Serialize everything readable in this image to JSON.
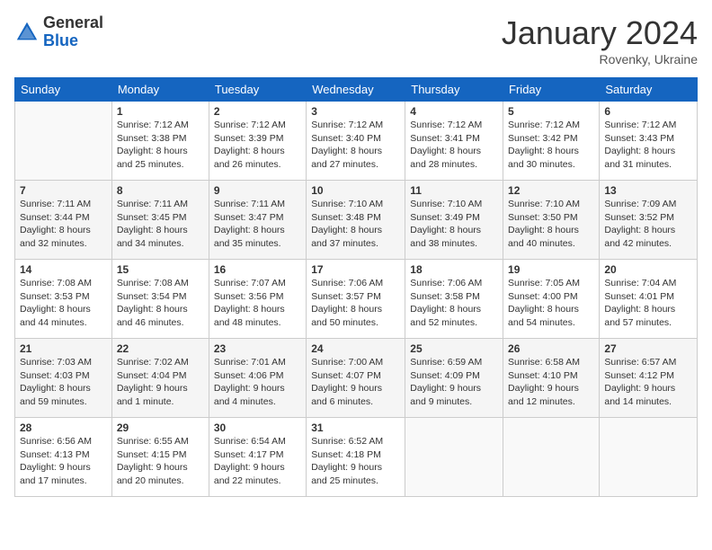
{
  "header": {
    "logo": {
      "general": "General",
      "blue": "Blue"
    },
    "title": "January 2024",
    "location": "Rovenky, Ukraine"
  },
  "weekdays": [
    "Sunday",
    "Monday",
    "Tuesday",
    "Wednesday",
    "Thursday",
    "Friday",
    "Saturday"
  ],
  "weeks": [
    [
      {
        "day": "",
        "empty": true
      },
      {
        "day": "1",
        "sunrise": "Sunrise: 7:12 AM",
        "sunset": "Sunset: 3:38 PM",
        "daylight": "Daylight: 8 hours and 25 minutes."
      },
      {
        "day": "2",
        "sunrise": "Sunrise: 7:12 AM",
        "sunset": "Sunset: 3:39 PM",
        "daylight": "Daylight: 8 hours and 26 minutes."
      },
      {
        "day": "3",
        "sunrise": "Sunrise: 7:12 AM",
        "sunset": "Sunset: 3:40 PM",
        "daylight": "Daylight: 8 hours and 27 minutes."
      },
      {
        "day": "4",
        "sunrise": "Sunrise: 7:12 AM",
        "sunset": "Sunset: 3:41 PM",
        "daylight": "Daylight: 8 hours and 28 minutes."
      },
      {
        "day": "5",
        "sunrise": "Sunrise: 7:12 AM",
        "sunset": "Sunset: 3:42 PM",
        "daylight": "Daylight: 8 hours and 30 minutes."
      },
      {
        "day": "6",
        "sunrise": "Sunrise: 7:12 AM",
        "sunset": "Sunset: 3:43 PM",
        "daylight": "Daylight: 8 hours and 31 minutes."
      }
    ],
    [
      {
        "day": "7",
        "sunrise": "Sunrise: 7:11 AM",
        "sunset": "Sunset: 3:44 PM",
        "daylight": "Daylight: 8 hours and 32 minutes."
      },
      {
        "day": "8",
        "sunrise": "Sunrise: 7:11 AM",
        "sunset": "Sunset: 3:45 PM",
        "daylight": "Daylight: 8 hours and 34 minutes."
      },
      {
        "day": "9",
        "sunrise": "Sunrise: 7:11 AM",
        "sunset": "Sunset: 3:47 PM",
        "daylight": "Daylight: 8 hours and 35 minutes."
      },
      {
        "day": "10",
        "sunrise": "Sunrise: 7:10 AM",
        "sunset": "Sunset: 3:48 PM",
        "daylight": "Daylight: 8 hours and 37 minutes."
      },
      {
        "day": "11",
        "sunrise": "Sunrise: 7:10 AM",
        "sunset": "Sunset: 3:49 PM",
        "daylight": "Daylight: 8 hours and 38 minutes."
      },
      {
        "day": "12",
        "sunrise": "Sunrise: 7:10 AM",
        "sunset": "Sunset: 3:50 PM",
        "daylight": "Daylight: 8 hours and 40 minutes."
      },
      {
        "day": "13",
        "sunrise": "Sunrise: 7:09 AM",
        "sunset": "Sunset: 3:52 PM",
        "daylight": "Daylight: 8 hours and 42 minutes."
      }
    ],
    [
      {
        "day": "14",
        "sunrise": "Sunrise: 7:08 AM",
        "sunset": "Sunset: 3:53 PM",
        "daylight": "Daylight: 8 hours and 44 minutes."
      },
      {
        "day": "15",
        "sunrise": "Sunrise: 7:08 AM",
        "sunset": "Sunset: 3:54 PM",
        "daylight": "Daylight: 8 hours and 46 minutes."
      },
      {
        "day": "16",
        "sunrise": "Sunrise: 7:07 AM",
        "sunset": "Sunset: 3:56 PM",
        "daylight": "Daylight: 8 hours and 48 minutes."
      },
      {
        "day": "17",
        "sunrise": "Sunrise: 7:06 AM",
        "sunset": "Sunset: 3:57 PM",
        "daylight": "Daylight: 8 hours and 50 minutes."
      },
      {
        "day": "18",
        "sunrise": "Sunrise: 7:06 AM",
        "sunset": "Sunset: 3:58 PM",
        "daylight": "Daylight: 8 hours and 52 minutes."
      },
      {
        "day": "19",
        "sunrise": "Sunrise: 7:05 AM",
        "sunset": "Sunset: 4:00 PM",
        "daylight": "Daylight: 8 hours and 54 minutes."
      },
      {
        "day": "20",
        "sunrise": "Sunrise: 7:04 AM",
        "sunset": "Sunset: 4:01 PM",
        "daylight": "Daylight: 8 hours and 57 minutes."
      }
    ],
    [
      {
        "day": "21",
        "sunrise": "Sunrise: 7:03 AM",
        "sunset": "Sunset: 4:03 PM",
        "daylight": "Daylight: 8 hours and 59 minutes."
      },
      {
        "day": "22",
        "sunrise": "Sunrise: 7:02 AM",
        "sunset": "Sunset: 4:04 PM",
        "daylight": "Daylight: 9 hours and 1 minute."
      },
      {
        "day": "23",
        "sunrise": "Sunrise: 7:01 AM",
        "sunset": "Sunset: 4:06 PM",
        "daylight": "Daylight: 9 hours and 4 minutes."
      },
      {
        "day": "24",
        "sunrise": "Sunrise: 7:00 AM",
        "sunset": "Sunset: 4:07 PM",
        "daylight": "Daylight: 9 hours and 6 minutes."
      },
      {
        "day": "25",
        "sunrise": "Sunrise: 6:59 AM",
        "sunset": "Sunset: 4:09 PM",
        "daylight": "Daylight: 9 hours and 9 minutes."
      },
      {
        "day": "26",
        "sunrise": "Sunrise: 6:58 AM",
        "sunset": "Sunset: 4:10 PM",
        "daylight": "Daylight: 9 hours and 12 minutes."
      },
      {
        "day": "27",
        "sunrise": "Sunrise: 6:57 AM",
        "sunset": "Sunset: 4:12 PM",
        "daylight": "Daylight: 9 hours and 14 minutes."
      }
    ],
    [
      {
        "day": "28",
        "sunrise": "Sunrise: 6:56 AM",
        "sunset": "Sunset: 4:13 PM",
        "daylight": "Daylight: 9 hours and 17 minutes."
      },
      {
        "day": "29",
        "sunrise": "Sunrise: 6:55 AM",
        "sunset": "Sunset: 4:15 PM",
        "daylight": "Daylight: 9 hours and 20 minutes."
      },
      {
        "day": "30",
        "sunrise": "Sunrise: 6:54 AM",
        "sunset": "Sunset: 4:17 PM",
        "daylight": "Daylight: 9 hours and 22 minutes."
      },
      {
        "day": "31",
        "sunrise": "Sunrise: 6:52 AM",
        "sunset": "Sunset: 4:18 PM",
        "daylight": "Daylight: 9 hours and 25 minutes."
      },
      {
        "day": "",
        "empty": true
      },
      {
        "day": "",
        "empty": true
      },
      {
        "day": "",
        "empty": true
      }
    ]
  ]
}
